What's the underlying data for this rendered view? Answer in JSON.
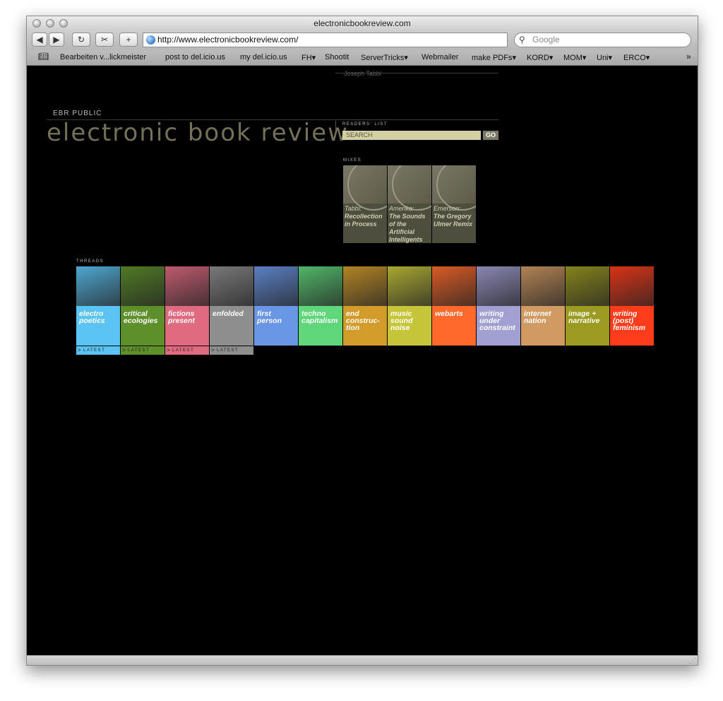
{
  "window": {
    "title": "electronicbookreview.com"
  },
  "toolbar": {
    "back": "◀",
    "forward": "▶",
    "reload": "↻",
    "snap": "✂",
    "add": "+",
    "url": "http://www.electronicbookreview.com/",
    "search_placeholder": "Google"
  },
  "bookmarks": [
    "Bearbeiten v...lickmeister",
    "post to del.icio.us",
    "my del.icio.us",
    "FH▾",
    "Shootit",
    "ServerTricks▾",
    "Webmailer",
    "make PDFs▾",
    "KORD▾",
    "MOM▾",
    "Uni▾",
    "ERCO▾"
  ],
  "bookmarks_more": "»",
  "page": {
    "cut_author": "Joseph Tabbi",
    "section": "EBR PUBLIC",
    "logo": "electronic book review",
    "readers_list_label": "READERS' LIST",
    "search_placeholder": "SEARCH",
    "go_label": "GO",
    "mixes_label": "MIXES",
    "mixes": [
      {
        "author": "Tabbi:",
        "title": "Recollection in Process"
      },
      {
        "author": "Amerika:",
        "title": "The Sounds of the Artificial Intelligents"
      },
      {
        "author": "Emerson:",
        "title": "The Gregory Ulmer Remix"
      }
    ],
    "threads_label": "THREADS",
    "threads": [
      {
        "label": "electro poetics",
        "color": "#5bc4f5"
      },
      {
        "label": "critical ecologies",
        "color": "#5d8f2b"
      },
      {
        "label": "fictions present",
        "color": "#e06a80"
      },
      {
        "label": "enfolded",
        "color": "#8e8e8e"
      },
      {
        "label": "first person",
        "color": "#6a96e6"
      },
      {
        "label": "techno capitalism",
        "color": "#5fd67a"
      },
      {
        "label": "end construc-tion",
        "color": "#d29b2a"
      },
      {
        "label": "music sound noise",
        "color": "#c6c53a"
      },
      {
        "label": "webarts",
        "color": "#ff6a2c"
      },
      {
        "label": "writing under constraint",
        "color": "#a29fd2"
      },
      {
        "label": "internet nation",
        "color": "#d29a63"
      },
      {
        "label": "image + narrative",
        "color": "#9c9a20"
      },
      {
        "label": "writing (post) feminism",
        "color": "#ff3c1a"
      }
    ],
    "latest_label": "LATEST",
    "latest_colors": [
      "#5bc4f5",
      "#5d8f2b",
      "#e06a80",
      "#8e8e8e"
    ]
  }
}
